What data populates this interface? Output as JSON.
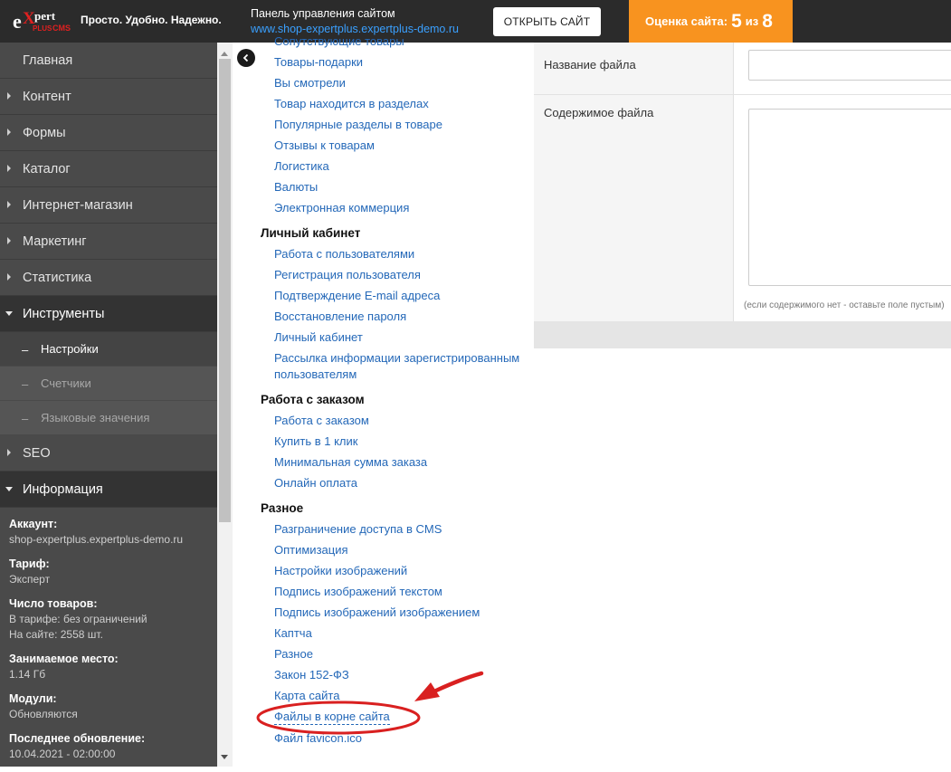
{
  "header": {
    "slogan": "Просто. Удобно. Надежно.",
    "panel_title": "Панель управления сайтом",
    "site_url": "www.shop-expertplus.expertplus-demo.ru",
    "open_site_label": "ОТКРЫТЬ САЙТ",
    "rating_prefix": "Оценка сайта:",
    "rating_value": "5",
    "rating_of": "из",
    "rating_max": "8",
    "logo_text": "eXpert plus CMS"
  },
  "sidebar": {
    "home": "Главная",
    "items": [
      {
        "label": "Контент"
      },
      {
        "label": "Формы"
      },
      {
        "label": "Каталог"
      },
      {
        "label": "Интернет-магазин"
      },
      {
        "label": "Маркетинг"
      },
      {
        "label": "Статистика"
      }
    ],
    "tools": "Инструменты",
    "tools_sub": [
      {
        "label": "Настройки"
      },
      {
        "label": "Счетчики"
      },
      {
        "label": "Языковые значения"
      }
    ],
    "seo": "SEO",
    "info": "Информация",
    "info_entries": [
      {
        "label": "Аккаунт:",
        "value": "shop-expertplus.expertplus-demo.ru"
      },
      {
        "label": "Тариф:",
        "value": "Эксперт"
      },
      {
        "label": "Число товаров:",
        "value": "В тарифе: без ограничений",
        "value2": "На сайте: 2558 шт."
      },
      {
        "label": "Занимаемое место:",
        "value": "1.14 Гб"
      },
      {
        "label": "Модули:",
        "value": "Обновляются"
      },
      {
        "label": "Последнее обновление:",
        "value": "10.04.2021 - 02:00:00"
      }
    ]
  },
  "links": {
    "partial_top": "Сопутствующие товары",
    "shop": [
      "Товары-подарки",
      "Вы смотрели",
      "Товар находится в разделах",
      "Популярные разделы в товаре",
      "Отзывы к товарам",
      "Логистика",
      "Валюты",
      "Электронная коммерция"
    ],
    "cabinet_title": "Личный кабинет",
    "cabinet": [
      "Работа с пользователями",
      "Регистрация пользователя",
      "Подтверждение E-mail адреса",
      "Восстановление пароля",
      "Личный кабинет"
    ],
    "cabinet_multi": "Рассылка информации зарегистрированным пользователям",
    "orders_title": "Работа с заказом",
    "orders": [
      "Работа с заказом",
      "Купить в 1 клик",
      "Минимальная сумма заказа",
      "Онлайн оплата"
    ],
    "misc_title": "Разное",
    "misc": [
      "Разграничение доступа в CMS",
      "Оптимизация",
      "Настройки изображений",
      "Подпись изображений текстом",
      "Подпись изображений изображением",
      "Каптча",
      "Разное",
      "Закон 152-ФЗ",
      "Карта сайта"
    ],
    "current": "Файлы в корне сайта",
    "after_current": "Файл favicon.ico"
  },
  "form": {
    "filename_label": "Название файла",
    "filename_value": "",
    "content_label": "Содержимое файла",
    "content_value": "",
    "hint": "(если содержимого нет - оставьте поле пустым)"
  },
  "colors": {
    "topbar": "#2b2b2b",
    "rating_bg": "#f8931f",
    "link": "#2468b8",
    "annotation": "#d92020"
  }
}
